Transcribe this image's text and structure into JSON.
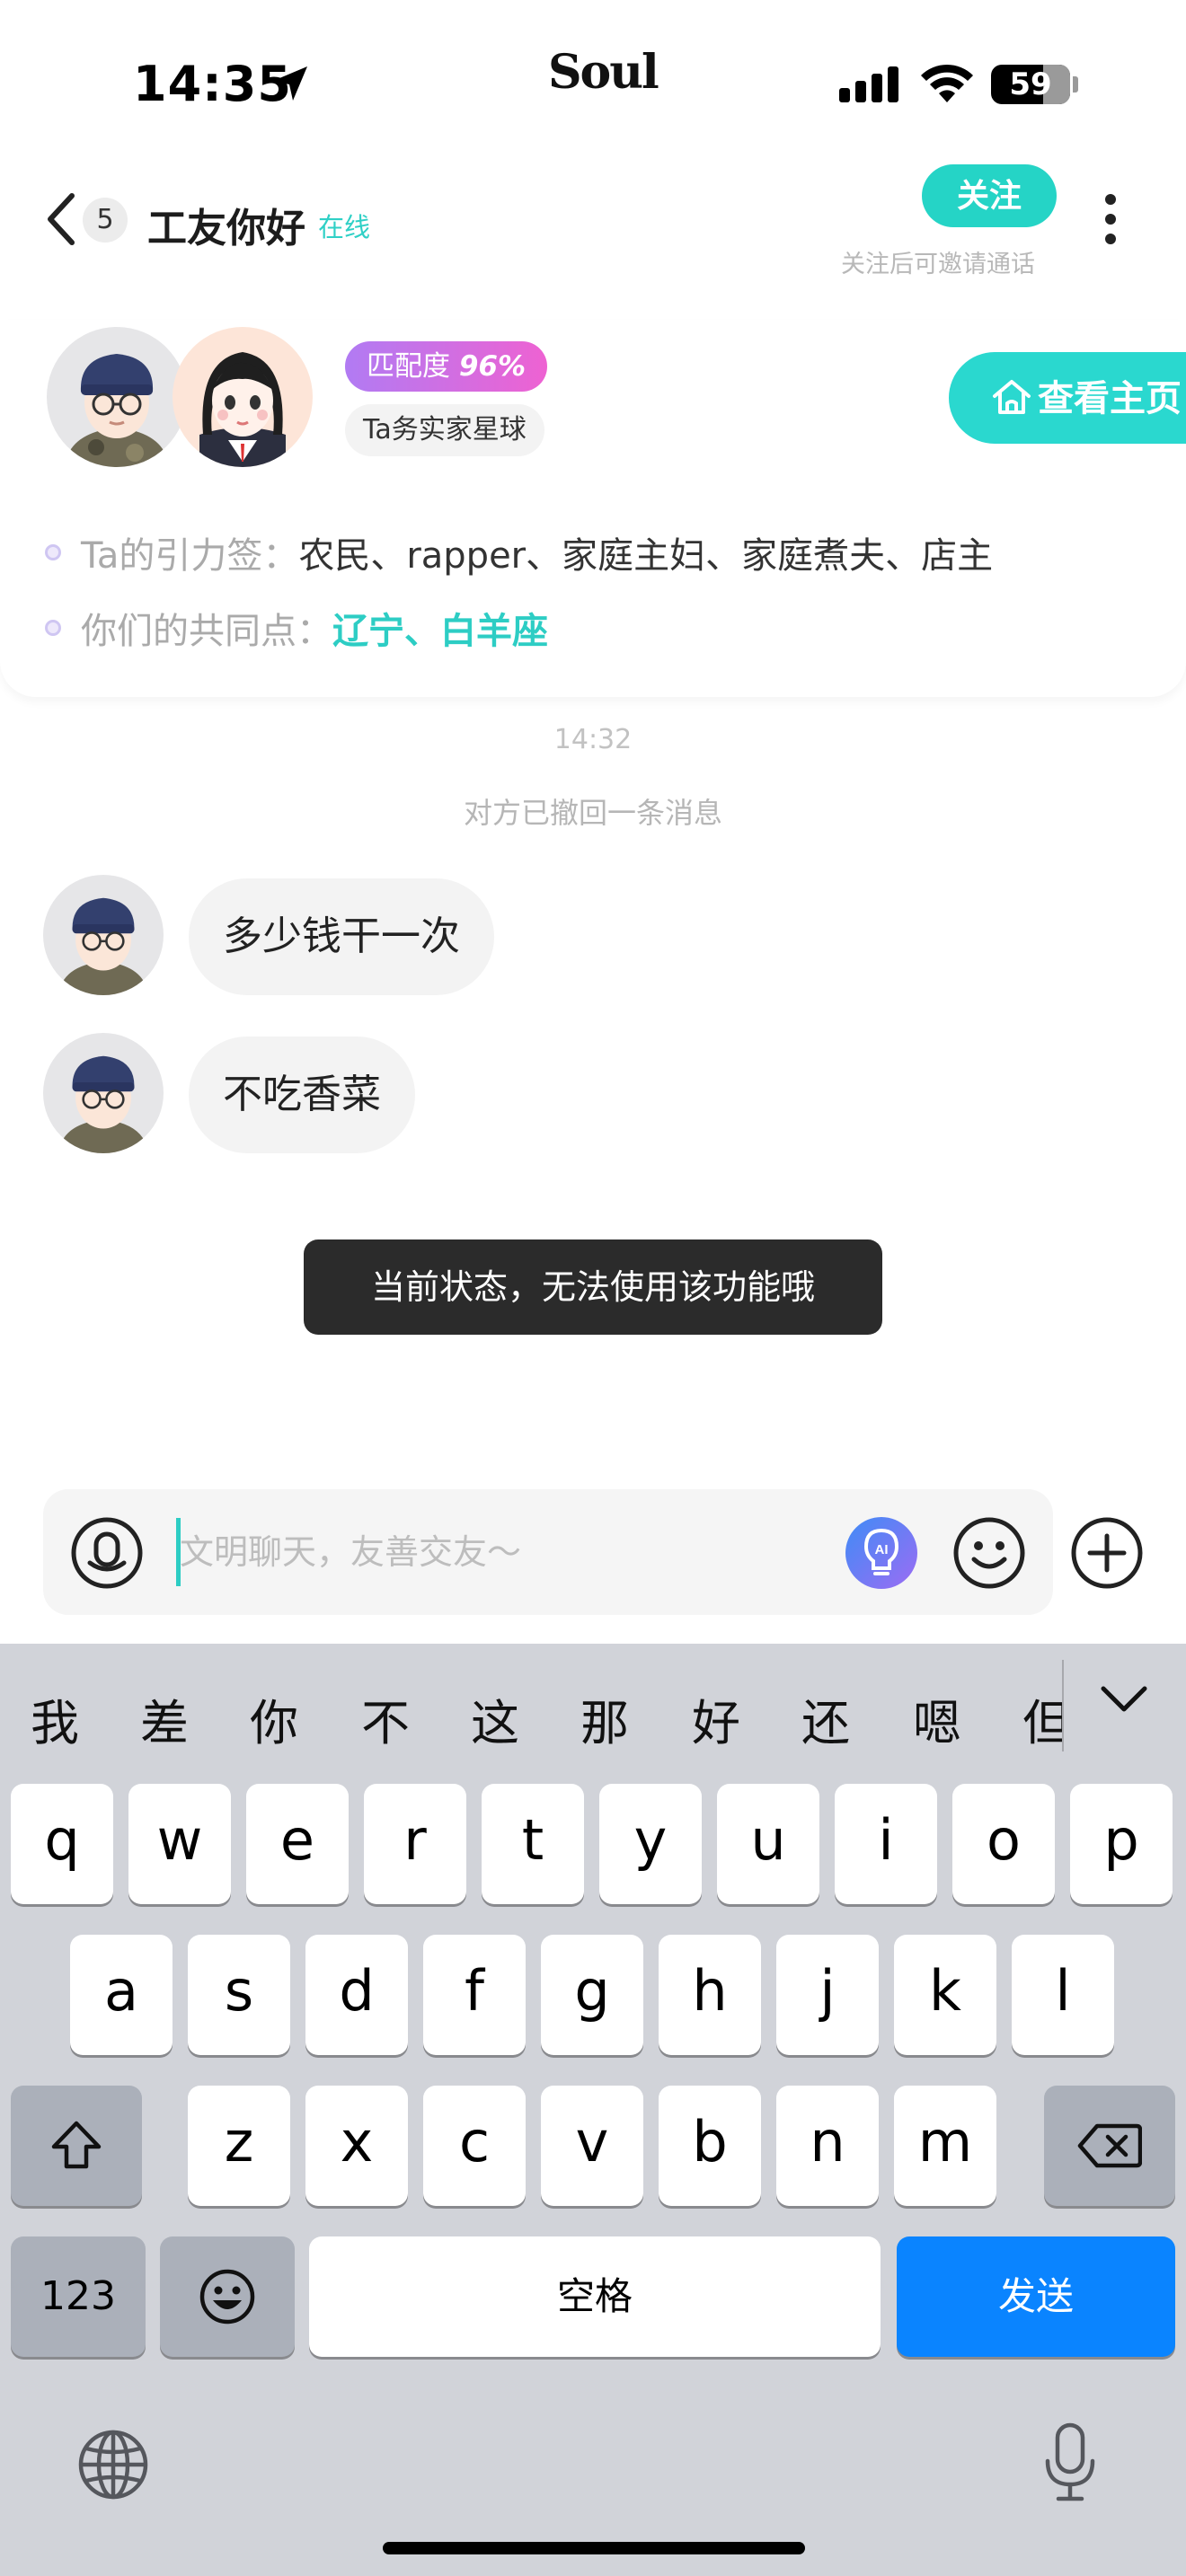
{
  "status_bar": {
    "time": "14:35",
    "brand": "Soul",
    "battery": "59"
  },
  "nav": {
    "unread_count": "5",
    "title": "工友你好",
    "online_status": "在线",
    "follow_label": "关注",
    "follow_hint": "关注后可邀请通话"
  },
  "profile_card": {
    "match_label": "匹配度",
    "match_value": "96%",
    "planet_tag": "Ta务实家星球",
    "view_profile_label": "查看主页",
    "tags_label": "Ta的引力签：",
    "tags_value": "农民、rapper、家庭主妇、家庭煮夫、店主",
    "common_label": "你们的共同点：",
    "common_value": "辽宁、白羊座"
  },
  "messages": {
    "timestamp": "14:32",
    "recall_notice": "对方已撤回一条消息",
    "items": [
      {
        "text": "多少钱干一次"
      },
      {
        "text": "不吃香菜"
      }
    ]
  },
  "toast": "当前状态，无法使用该功能哦",
  "input": {
    "placeholder": "文明聊天，友善交友～",
    "value": ""
  },
  "keyboard": {
    "candidates": [
      "我",
      "差",
      "你",
      "不",
      "这",
      "那",
      "好",
      "还",
      "嗯",
      "但"
    ],
    "row1": [
      "q",
      "w",
      "e",
      "r",
      "t",
      "y",
      "u",
      "i",
      "o",
      "p"
    ],
    "row2": [
      "a",
      "s",
      "d",
      "f",
      "g",
      "h",
      "j",
      "k",
      "l"
    ],
    "row3": [
      "z",
      "x",
      "c",
      "v",
      "b",
      "n",
      "m"
    ],
    "num_label": "123",
    "space_label": "空格",
    "send_label": "发送"
  },
  "colors": {
    "accent": "#25d4c6",
    "send": "#0a84ff",
    "match_gradient_start": "#b17bf3",
    "match_gradient_end": "#ee62d2"
  }
}
